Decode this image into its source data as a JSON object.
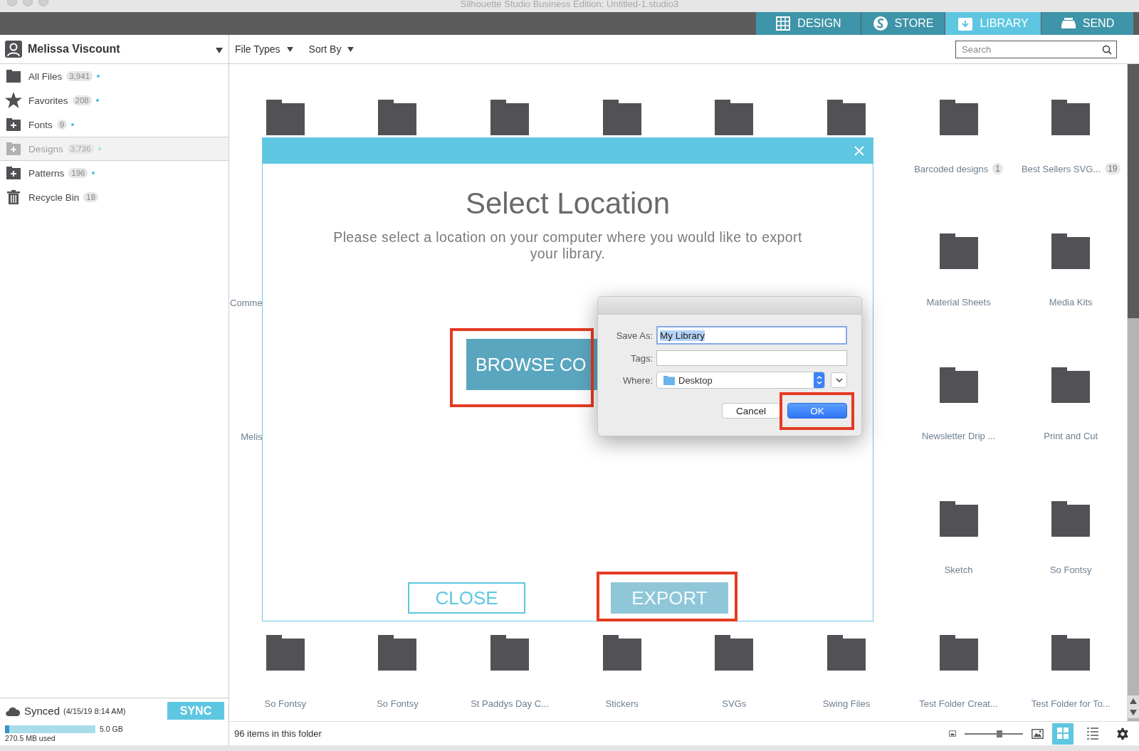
{
  "window": {
    "title": "Silhouette Studio Business Edition: Untitled-1.studio3"
  },
  "nav_tabs": [
    {
      "kind": "design",
      "label": "DESIGN",
      "selected": false
    },
    {
      "kind": "store",
      "label": "STORE",
      "selected": false
    },
    {
      "kind": "library",
      "label": "LIBRARY",
      "selected": true
    },
    {
      "kind": "send",
      "label": "SEND",
      "selected": false
    }
  ],
  "account": {
    "name": "Melissa Viscount"
  },
  "toolbar": {
    "filters": [
      "File Types",
      "Sort By"
    ],
    "search": {
      "placeholder": "Search"
    }
  },
  "sidebar": {
    "items": [
      {
        "kind": "folder",
        "label": "All Files",
        "count": "3,941",
        "synced": true,
        "selected": false
      },
      {
        "kind": "star",
        "label": "Favorites",
        "count": "208",
        "synced": true,
        "selected": false
      },
      {
        "kind": "folder_plus",
        "label": "Fonts",
        "count": "9",
        "synced": true,
        "selected": false
      },
      {
        "kind": "folder_plus",
        "label": "Designs",
        "count": "3,736",
        "synced": true,
        "selected": true
      },
      {
        "kind": "folder_plus",
        "label": "Patterns",
        "count": "196",
        "synced": true,
        "selected": false
      },
      {
        "kind": "trash",
        "label": "Recycle Bin",
        "count": "18",
        "synced": false,
        "selected": false
      }
    ],
    "sync": {
      "status": "Synced",
      "time": "(4/15/19 8:14 AM)",
      "button": "SYNC",
      "storage": {
        "level": 0.05,
        "capacity": "5.0 GB",
        "used": "270.5 MB used"
      }
    }
  },
  "library": {
    "rows": [
      [
        {
          "kind": "folder"
        },
        {
          "kind": "folder"
        },
        {
          "kind": "folder"
        },
        {
          "kind": "folder"
        },
        {
          "kind": "folder"
        },
        {
          "kind": "folder"
        },
        {
          "kind": "folder",
          "label": "Barcoded designs",
          "badge": "1"
        },
        {
          "kind": "folder",
          "label": "Best Sellers SVG...",
          "badge": "19"
        }
      ],
      [
        {
          "kind": "cut_label",
          "label": "Comme"
        },
        {
          "kind": "covered"
        },
        {
          "kind": "covered"
        },
        {
          "kind": "covered"
        },
        {
          "kind": "covered"
        },
        {
          "kind": "covered"
        },
        {
          "kind": "folder",
          "label": "Material Sheets"
        },
        {
          "kind": "folder",
          "label": "Media Kits"
        }
      ],
      [
        {
          "kind": "cut_label",
          "label": "Melis"
        },
        {
          "kind": "covered"
        },
        {
          "kind": "covered"
        },
        {
          "kind": "covered"
        },
        {
          "kind": "covered"
        },
        {
          "kind": "covered"
        },
        {
          "kind": "folder",
          "label": "Newsletter Drip ..."
        },
        {
          "kind": "folder",
          "label": "Print and Cut"
        }
      ],
      [
        {
          "kind": "covered"
        },
        {
          "kind": "covered"
        },
        {
          "kind": "covered"
        },
        {
          "kind": "covered"
        },
        {
          "kind": "covered"
        },
        {
          "kind": "covered"
        },
        {
          "kind": "folder",
          "label": "Sketch"
        },
        {
          "kind": "folder",
          "label": "So Fontsy"
        }
      ],
      [
        {
          "kind": "folder",
          "label": "So Fontsy"
        },
        {
          "kind": "folder",
          "label": "So Fontsy"
        },
        {
          "kind": "folder",
          "label": "St Paddys Day C..."
        },
        {
          "kind": "folder",
          "label": "Stickers"
        },
        {
          "kind": "folder",
          "label": "SVGs"
        },
        {
          "kind": "folder",
          "label": "Swing Files"
        },
        {
          "kind": "folder",
          "label": "Test Folder Creat..."
        },
        {
          "kind": "folder",
          "label": "Test Folder for To..."
        }
      ]
    ]
  },
  "status_bar": {
    "item_count": "96 items in this folder",
    "zoom": {
      "level": 0.6
    },
    "views": [
      {
        "kind": "grid",
        "selected": true
      },
      {
        "kind": "list",
        "selected": false
      }
    ]
  },
  "dialog": {
    "title": "Select Location",
    "description": "Please select a location on your computer where you would like to export your library.",
    "browse_button": {
      "label": "BROWSE CO",
      "highlighted": true
    },
    "buttons": [
      {
        "kind": "close",
        "label": "CLOSE",
        "disabled": false,
        "highlighted": false
      },
      {
        "kind": "export",
        "label": "EXPORT",
        "disabled": true,
        "highlighted": true
      }
    ]
  },
  "save_sheet": {
    "fields": [
      {
        "kind": "text",
        "label": "Save As:",
        "value": "My Library",
        "focused": true
      },
      {
        "kind": "text",
        "label": "Tags:",
        "focused": false
      },
      {
        "kind": "popup",
        "label": "Where:",
        "value": "Desktop"
      }
    ],
    "buttons": [
      {
        "label": "Cancel",
        "default": false,
        "highlighted": false
      },
      {
        "label": "OK",
        "default": true,
        "highlighted": true
      }
    ]
  }
}
